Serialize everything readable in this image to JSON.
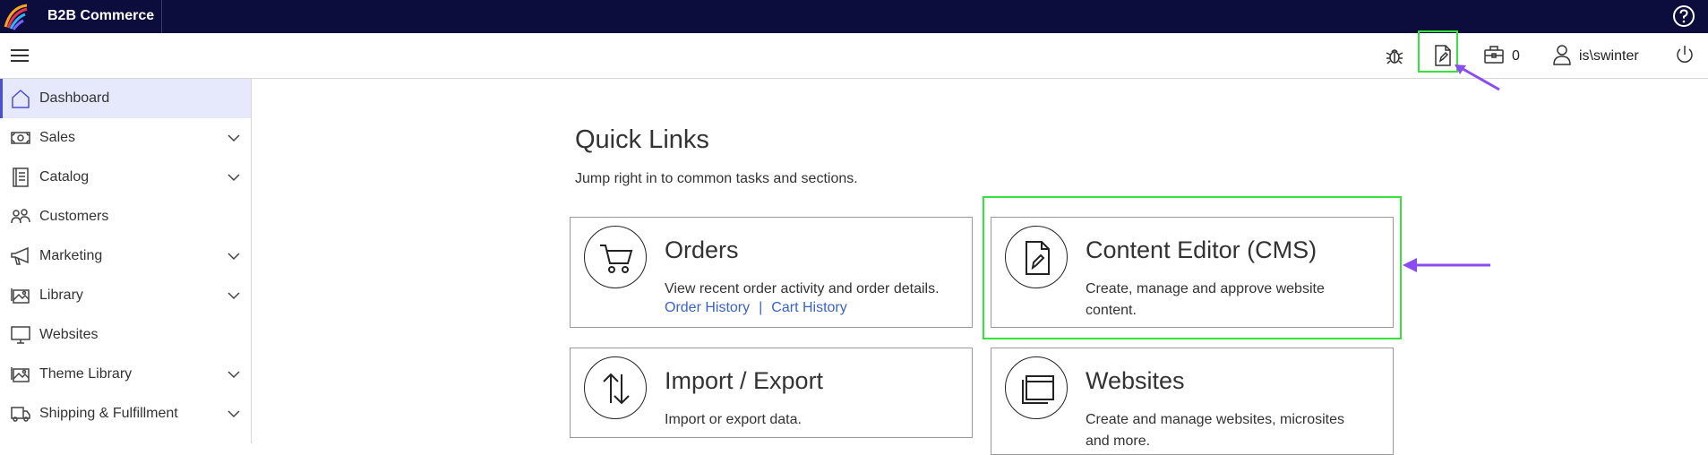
{
  "topbar": {
    "app_title": "B2B Commerce",
    "logo_icon": "brand-logo-icon",
    "help_icon": "help-circle-icon",
    "background": "#0d0d3d"
  },
  "subbar": {
    "menu_icon": "hamburger-menu-icon",
    "bug_icon": "bug-icon",
    "content_edit_icon": "page-edit-icon",
    "cart_icon": "briefcase-icon",
    "cart_count": "0",
    "user_icon": "user-icon",
    "username": "is\\swinter",
    "power_icon": "power-icon"
  },
  "sidebar": {
    "items": [
      {
        "label": "Dashboard",
        "icon": "home-icon",
        "active": true,
        "expandable": false
      },
      {
        "label": "Sales",
        "icon": "money-icon",
        "active": false,
        "expandable": true
      },
      {
        "label": "Catalog",
        "icon": "catalog-icon",
        "active": false,
        "expandable": true
      },
      {
        "label": "Customers",
        "icon": "customers-icon",
        "active": false,
        "expandable": false
      },
      {
        "label": "Marketing",
        "icon": "megaphone-icon",
        "active": false,
        "expandable": true
      },
      {
        "label": "Library",
        "icon": "library-icon",
        "active": false,
        "expandable": true
      },
      {
        "label": "Websites",
        "icon": "monitor-icon",
        "active": false,
        "expandable": false
      },
      {
        "label": "Theme Library",
        "icon": "theme-library-icon",
        "active": false,
        "expandable": true
      },
      {
        "label": "Shipping & Fulfillment",
        "icon": "truck-icon",
        "active": false,
        "expandable": true
      }
    ],
    "active_color": "#e6e8fb"
  },
  "main": {
    "title": "Quick Links",
    "subtitle": "Jump right in to common tasks and sections.",
    "cards": [
      {
        "title": "Orders",
        "description": "View recent order activity and order details.",
        "icon": "shopping-cart-icon",
        "links": [
          "Order History",
          "Cart History"
        ]
      },
      {
        "title": "Content Editor (CMS)",
        "description_line1": "Create, manage and approve website",
        "description_line2": "content.",
        "icon": "page-edit-icon"
      },
      {
        "title": "Import / Export",
        "description": "Import or export data.",
        "icon": "import-export-icon"
      },
      {
        "title": "Websites",
        "description_line1": "Create and manage websites, microsites",
        "description_line2": "and more.",
        "icon": "browser-window-icon"
      }
    ],
    "highlight_color": "#37e23a",
    "annotation_color": "#8b4cf0",
    "link_color": "#3a63c6"
  }
}
